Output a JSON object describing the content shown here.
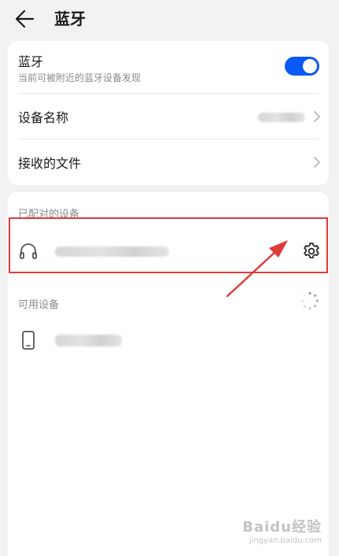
{
  "header": {
    "title": "蓝牙",
    "back_icon": "arrow-left-icon"
  },
  "bluetooth": {
    "title": "蓝牙",
    "subtitle": "当前可被附近的蓝牙设备发现",
    "enabled": true,
    "toggle_color": "#0a59f7"
  },
  "device_name": {
    "label": "设备名称"
  },
  "received_files": {
    "label": "接收的文件"
  },
  "paired": {
    "section_label": "已配对的设备",
    "devices": [
      {
        "icon": "headphones-icon",
        "settings_icon": "gear-icon"
      }
    ]
  },
  "available": {
    "section_label": "可用设备",
    "devices": [
      {
        "icon": "phone-icon"
      }
    ]
  },
  "annotation": {
    "color": "#e03a3a"
  },
  "watermark": {
    "logo": "Baidu经验",
    "url": "jingyan.baidu.com"
  }
}
